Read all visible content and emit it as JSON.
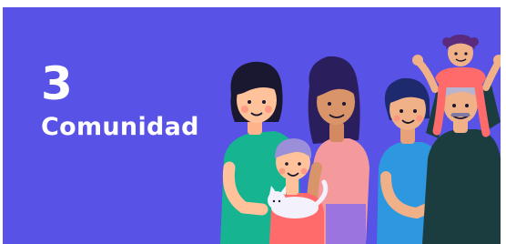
{
  "slide": {
    "number": "3",
    "title": "Comunidad"
  },
  "illustration": {
    "icon": "family-group-illustration"
  },
  "colors": {
    "background": "#5852e6",
    "text": "#ffffff"
  }
}
